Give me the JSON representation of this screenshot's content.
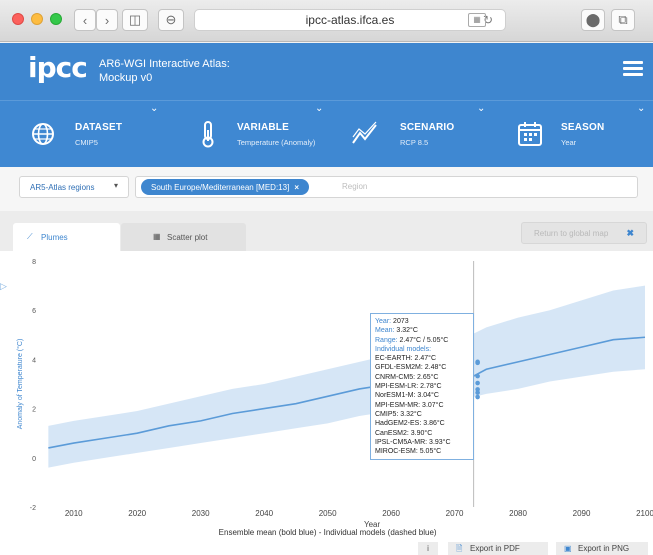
{
  "browser": {
    "url": "ipcc-atlas.ifca.es",
    "back_icon": "chevron-left-icon",
    "forward_icon": "chevron-right-icon"
  },
  "header": {
    "logo": "ipcc",
    "title_line1": "AR6-WGI Interactive Atlas:",
    "title_line2": "Mockup v0",
    "brand_color": "#3e86cf"
  },
  "selectors": [
    {
      "label": "DATASET",
      "value": "CMIP5",
      "icon": "globe-icon"
    },
    {
      "label": "VARIABLE",
      "value": "Temperature (Anomaly)",
      "icon": "thermometer-icon"
    },
    {
      "label": "SCENARIO",
      "value": "RCP 8.5",
      "icon": "trend-icon"
    },
    {
      "label": "SEASON",
      "value": "Year",
      "icon": "calendar-icon"
    }
  ],
  "region": {
    "dropdown": "AR5-Atlas regions",
    "chip": "South Europe/Mediterranean [MED:13]",
    "placeholder": "Region"
  },
  "tabs": {
    "plumes": "Plumes",
    "scatter": "Scatter plot",
    "return": "Return to global map"
  },
  "tooltip": {
    "year_label": "Year:",
    "year": "2073",
    "mean_label": "Mean:",
    "mean": "3.32°C",
    "range_label": "Range:",
    "range": "2.47°C / 5.05°C",
    "models_label": "Individual models:",
    "models": [
      "EC-EARTH: 2.47°C",
      "GFDL-ESM2M: 2.48°C",
      "CNRM-CM5: 2.65°C",
      "MPI-ESM-LR: 2.78°C",
      "NorESM1-M: 3.04°C",
      "MPI-ESM-MR: 3.07°C",
      "CMIP5: 3.32°C",
      "HadGEM2-ES: 3.86°C",
      "CanESM2: 3.90°C",
      "IPSL-CM5A-MR: 3.93°C",
      "MIROC-ESM: 5.05°C"
    ]
  },
  "footer": {
    "info": "i",
    "export_pdf": "Export in PDF",
    "export_png": "Export in PNG"
  },
  "chart_data": {
    "type": "area",
    "xlabel": "Year",
    "caption": "Ensemble mean (bold blue) - Individual models (dashed blue)",
    "ylabel": "Anomaly of Temperature (°C)",
    "xlim": [
      2005,
      2100
    ],
    "ylim": [
      -2,
      8
    ],
    "x_ticks": [
      2010,
      2020,
      2030,
      2040,
      2050,
      2060,
      2070,
      2080,
      2090,
      2100
    ],
    "y_ticks": [
      -2,
      0,
      2,
      4,
      6,
      8
    ],
    "grid": false,
    "hover_year": 2073,
    "colors": {
      "mean": "#5b9bd8",
      "band": "#cfe2f5",
      "hover": "#bbbbbb"
    },
    "x": [
      2006,
      2010,
      2015,
      2020,
      2025,
      2030,
      2035,
      2040,
      2045,
      2050,
      2055,
      2060,
      2065,
      2070,
      2073,
      2075,
      2080,
      2085,
      2090,
      2095,
      2100
    ],
    "series": [
      {
        "name": "Ensemble mean",
        "values": [
          0.4,
          0.6,
          0.8,
          1.0,
          1.3,
          1.5,
          1.8,
          2.0,
          2.2,
          2.5,
          2.8,
          3.0,
          3.2,
          3.3,
          3.32,
          3.6,
          3.9,
          4.2,
          4.5,
          4.8,
          4.9
        ]
      },
      {
        "name": "Range low",
        "values": [
          -0.4,
          -0.2,
          0.0,
          0.2,
          0.4,
          0.6,
          0.8,
          1.0,
          1.2,
          1.4,
          1.7,
          1.9,
          2.1,
          2.3,
          2.47,
          2.6,
          2.8,
          3.1,
          3.3,
          3.5,
          3.6
        ]
      },
      {
        "name": "Range high",
        "values": [
          1.3,
          1.5,
          1.7,
          1.9,
          2.2,
          2.5,
          2.8,
          3.0,
          3.3,
          3.6,
          3.9,
          4.2,
          4.5,
          4.8,
          5.05,
          5.3,
          5.7,
          6.0,
          6.4,
          6.8,
          7.0
        ]
      }
    ]
  }
}
